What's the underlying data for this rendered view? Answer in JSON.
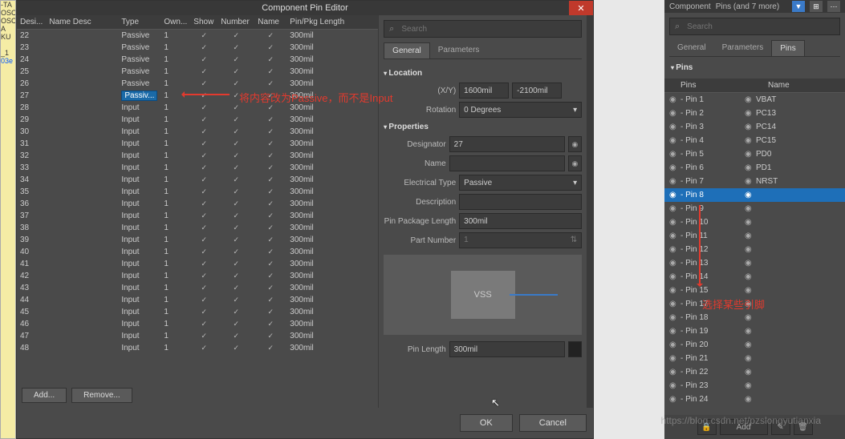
{
  "dialog": {
    "title": "Component Pin Editor",
    "close_glyph": "✕",
    "columns": {
      "desi": "Desi...",
      "name_desc": "Name Desc",
      "type": "Type",
      "own": "Own...",
      "show": "Show",
      "number": "Number",
      "name": "Name",
      "pkg": "Pin/Pkg Length"
    },
    "rows": [
      {
        "desi": "22",
        "type": "Passive",
        "own": "1",
        "pkg": "300mil",
        "sel": false
      },
      {
        "desi": "23",
        "type": "Passive",
        "own": "1",
        "pkg": "300mil",
        "sel": false
      },
      {
        "desi": "24",
        "type": "Passive",
        "own": "1",
        "pkg": "300mil",
        "sel": false
      },
      {
        "desi": "25",
        "type": "Passive",
        "own": "1",
        "pkg": "300mil",
        "sel": false
      },
      {
        "desi": "26",
        "type": "Passive",
        "own": "1",
        "pkg": "300mil",
        "sel": false
      },
      {
        "desi": "27",
        "type": "Passiv...",
        "own": "1",
        "pkg": "300mil",
        "sel": true
      },
      {
        "desi": "28",
        "type": "Input",
        "own": "1",
        "pkg": "300mil",
        "sel": false
      },
      {
        "desi": "29",
        "type": "Input",
        "own": "1",
        "pkg": "300mil",
        "sel": false
      },
      {
        "desi": "30",
        "type": "Input",
        "own": "1",
        "pkg": "300mil",
        "sel": false
      },
      {
        "desi": "31",
        "type": "Input",
        "own": "1",
        "pkg": "300mil",
        "sel": false
      },
      {
        "desi": "32",
        "type": "Input",
        "own": "1",
        "pkg": "300mil",
        "sel": false
      },
      {
        "desi": "33",
        "type": "Input",
        "own": "1",
        "pkg": "300mil",
        "sel": false
      },
      {
        "desi": "34",
        "type": "Input",
        "own": "1",
        "pkg": "300mil",
        "sel": false
      },
      {
        "desi": "35",
        "type": "Input",
        "own": "1",
        "pkg": "300mil",
        "sel": false
      },
      {
        "desi": "36",
        "type": "Input",
        "own": "1",
        "pkg": "300mil",
        "sel": false
      },
      {
        "desi": "37",
        "type": "Input",
        "own": "1",
        "pkg": "300mil",
        "sel": false
      },
      {
        "desi": "38",
        "type": "Input",
        "own": "1",
        "pkg": "300mil",
        "sel": false
      },
      {
        "desi": "39",
        "type": "Input",
        "own": "1",
        "pkg": "300mil",
        "sel": false
      },
      {
        "desi": "40",
        "type": "Input",
        "own": "1",
        "pkg": "300mil",
        "sel": false
      },
      {
        "desi": "41",
        "type": "Input",
        "own": "1",
        "pkg": "300mil",
        "sel": false
      },
      {
        "desi": "42",
        "type": "Input",
        "own": "1",
        "pkg": "300mil",
        "sel": false
      },
      {
        "desi": "43",
        "type": "Input",
        "own": "1",
        "pkg": "300mil",
        "sel": false
      },
      {
        "desi": "44",
        "type": "Input",
        "own": "1",
        "pkg": "300mil",
        "sel": false
      },
      {
        "desi": "45",
        "type": "Input",
        "own": "1",
        "pkg": "300mil",
        "sel": false
      },
      {
        "desi": "46",
        "type": "Input",
        "own": "1",
        "pkg": "300mil",
        "sel": false
      },
      {
        "desi": "47",
        "type": "Input",
        "own": "1",
        "pkg": "300mil",
        "sel": false
      },
      {
        "desi": "48",
        "type": "Input",
        "own": "1",
        "pkg": "300mil",
        "sel": false
      }
    ],
    "footer": {
      "add": "Add...",
      "remove": "Remove...",
      "ok": "OK",
      "cancel": "Cancel"
    }
  },
  "right": {
    "search_placeholder": "Search",
    "tabs": {
      "general": "General",
      "parameters": "Parameters"
    },
    "sections": {
      "location": "Location",
      "properties": "Properties"
    },
    "location": {
      "xy_label": "(X/Y)",
      "x": "1600mil",
      "y": "-2100mil",
      "rotation_label": "Rotation",
      "rotation": "0 Degrees"
    },
    "props": {
      "designator_label": "Designator",
      "designator": "27",
      "name_label": "Name",
      "name": "",
      "etype_label": "Electrical Type",
      "etype": "Passive",
      "desc_label": "Description",
      "desc": "",
      "pkg_label": "Pin Package Length",
      "pkg": "300mil",
      "part_label": "Part Number",
      "part": "1",
      "preview_label": "VSS",
      "pinlen_label": "Pin Length",
      "pinlen": "300mil"
    }
  },
  "side": {
    "header": {
      "component": "Component",
      "pins": "Pins (and 7 more)"
    },
    "search_placeholder": "Search",
    "tabs": {
      "general": "General",
      "parameters": "Parameters",
      "pins": "Pins"
    },
    "section": "Pins",
    "cols": {
      "pins": "Pins",
      "name": "Name"
    },
    "rows": [
      {
        "pin": "- Pin 1",
        "name": "VBAT",
        "sel": false
      },
      {
        "pin": "- Pin 2",
        "name": "PC13",
        "sel": false
      },
      {
        "pin": "- Pin 3",
        "name": "PC14",
        "sel": false
      },
      {
        "pin": "- Pin 4",
        "name": "PC15",
        "sel": false
      },
      {
        "pin": "- Pin 5",
        "name": "PD0",
        "sel": false
      },
      {
        "pin": "- Pin 6",
        "name": "PD1",
        "sel": false
      },
      {
        "pin": "- Pin 7",
        "name": "NRST",
        "sel": false
      },
      {
        "pin": "- Pin 8",
        "name": "",
        "sel": true
      },
      {
        "pin": "- Pin 9",
        "name": "",
        "sel": false
      },
      {
        "pin": "- Pin 10",
        "name": "",
        "sel": false
      },
      {
        "pin": "- Pin 11",
        "name": "",
        "sel": false
      },
      {
        "pin": "- Pin 12",
        "name": "",
        "sel": false
      },
      {
        "pin": "- Pin 13",
        "name": "",
        "sel": false
      },
      {
        "pin": "- Pin 14",
        "name": "",
        "sel": false
      },
      {
        "pin": "- Pin 15",
        "name": "",
        "sel": false
      },
      {
        "pin": "- Pin 17",
        "name": "",
        "sel": false
      },
      {
        "pin": "- Pin 18",
        "name": "",
        "sel": false
      },
      {
        "pin": "- Pin 19",
        "name": "",
        "sel": false
      },
      {
        "pin": "- Pin 20",
        "name": "",
        "sel": false
      },
      {
        "pin": "- Pin 21",
        "name": "",
        "sel": false
      },
      {
        "pin": "- Pin 22",
        "name": "",
        "sel": false
      },
      {
        "pin": "- Pin 23",
        "name": "",
        "sel": false
      },
      {
        "pin": "- Pin 24",
        "name": "",
        "sel": false
      }
    ],
    "footer": {
      "add": "Add"
    }
  },
  "annotations": {
    "a1": "将内容改为Passive，而不是Input",
    "a2": "选择某些引脚"
  },
  "watermark": "https://blog.csdn.net/pzslongyutianxia"
}
